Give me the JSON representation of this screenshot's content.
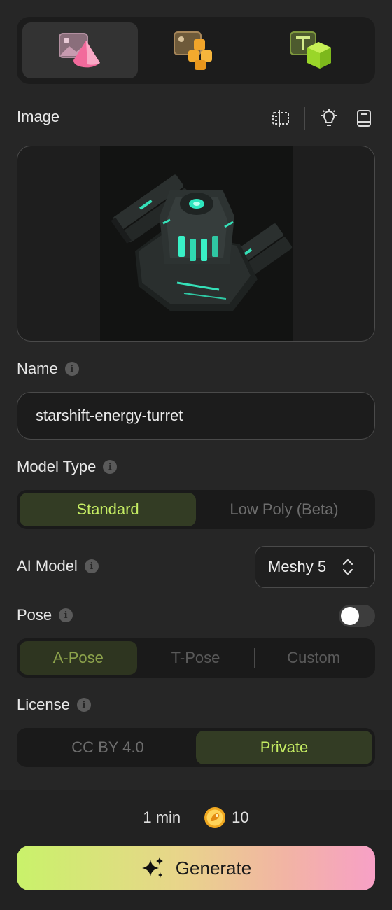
{
  "mode_tabs": [
    {
      "icon": "image-to-3d-icon",
      "active": true
    },
    {
      "icon": "multi-image-to-3d-icon",
      "active": false
    },
    {
      "icon": "text-to-3d-icon",
      "active": false
    }
  ],
  "image_section": {
    "label": "Image",
    "tools": [
      "crop-compare-icon",
      "lightbulb-icon",
      "book-icon"
    ]
  },
  "name_section": {
    "label": "Name",
    "value": "starshift-energy-turret"
  },
  "model_type": {
    "label": "Model Type",
    "options": [
      "Standard",
      "Low Poly (Beta)"
    ],
    "selected": "Standard"
  },
  "ai_model": {
    "label": "AI Model",
    "value": "Meshy 5"
  },
  "pose": {
    "label": "Pose",
    "enabled": false,
    "options": [
      "A-Pose",
      "T-Pose",
      "Custom"
    ],
    "selected": "A-Pose"
  },
  "license": {
    "label": "License",
    "options": [
      "CC BY 4.0",
      "Private"
    ],
    "selected": "Private"
  },
  "footer": {
    "time": "1 min",
    "credits": "10",
    "generate_label": "Generate"
  },
  "colors": {
    "accent": "#c5ec63",
    "background": "#262626"
  }
}
